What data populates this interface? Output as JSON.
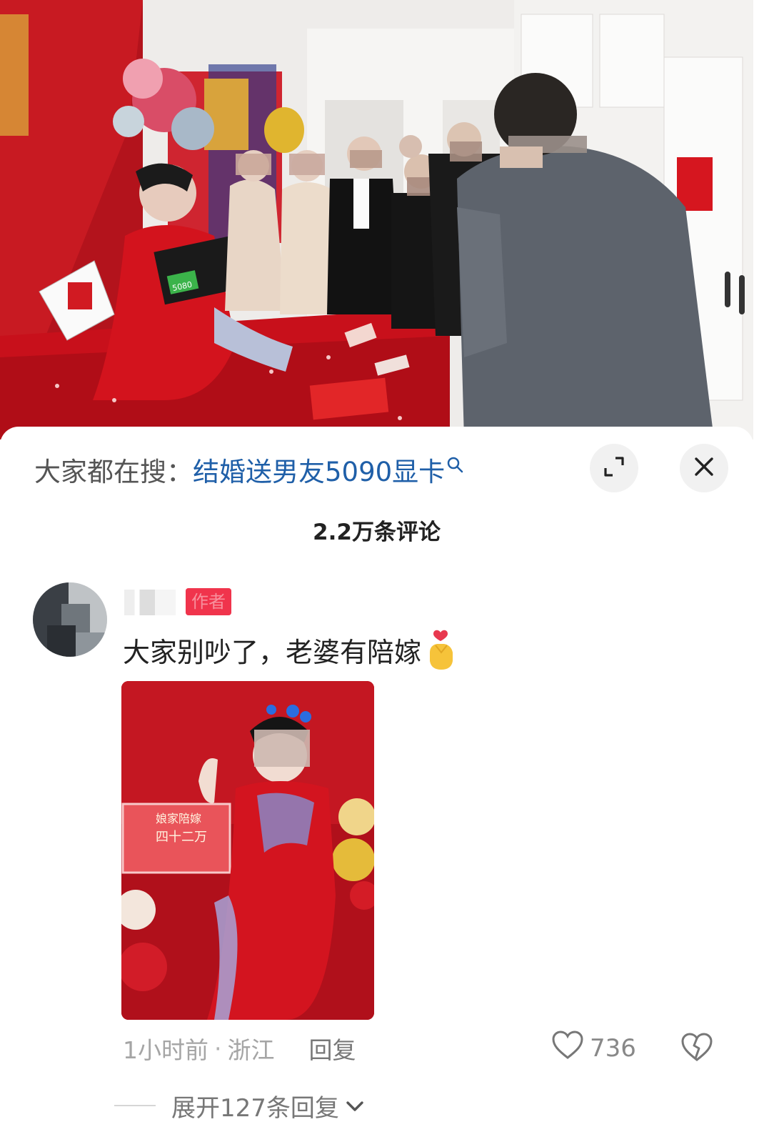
{
  "search": {
    "prefix": "大家都在搜：",
    "query": "结婚送男友5090显卡"
  },
  "comments": {
    "count_label": "2.2万条评论"
  },
  "comment": {
    "author_badge": "作者",
    "text": "大家别吵了，老婆有陪嫁",
    "time": "1小时前",
    "location": "浙江",
    "reply_label": "回复",
    "like_count": "736",
    "expand_label": "展开127条回复"
  },
  "photo": {
    "banner_line1": "娘家陪嫁",
    "banner_line2": "四十二万"
  },
  "video": {
    "box_label": "5080"
  },
  "icons": {
    "expand": "expand-icon",
    "close": "close-icon",
    "search": "search-icon",
    "like": "heart-icon",
    "dislike": "broken-heart-icon",
    "chevron": "chevron-down-icon",
    "emoji": "finger-heart-emoji"
  },
  "colors": {
    "query": "#1f5fa8",
    "author_badge": "#f0344c",
    "wedding_red": "#c8102e"
  }
}
